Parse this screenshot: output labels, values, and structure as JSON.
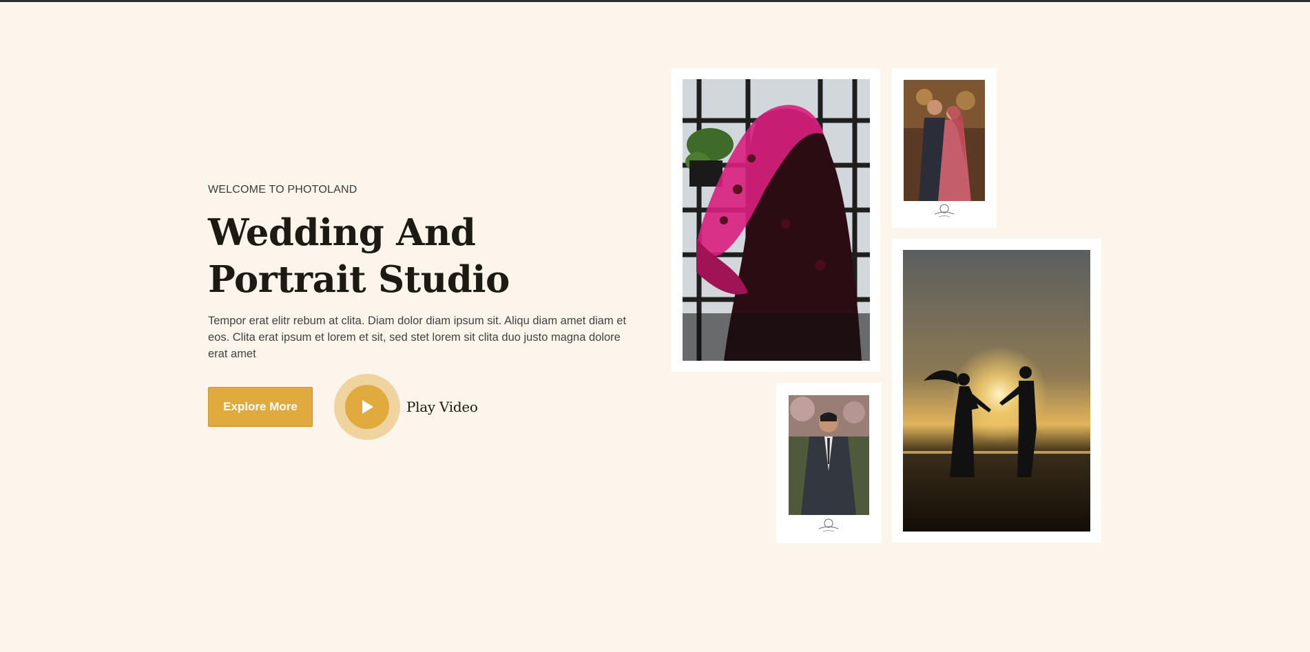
{
  "hero": {
    "eyebrow": "WELCOME TO PHOTOLAND",
    "title": "Wedding And Portrait Studio",
    "description": "Tempor erat elitr rebum at clita. Diam dolor diam ipsum sit. Aliqu diam amet diam et eos. Clita erat ipsum et lorem et sit, sed stet lorem sit clita duo justo magna dolore erat amet"
  },
  "actions": {
    "explore_label": "Explore More",
    "play_label": "Play Video",
    "play_icon": "play-icon"
  },
  "gallery": {
    "photos": [
      {
        "subject": "bride-in-pink-veil"
      },
      {
        "subject": "wedding-couple-portrait"
      },
      {
        "subject": "groom-in-suit"
      },
      {
        "subject": "couple-silhouette-sunset"
      }
    ]
  },
  "colors": {
    "background": "#fcf5eb",
    "accent": "#e0aa3e",
    "accent_light": "#efd4a0",
    "heading": "#1d1913"
  }
}
